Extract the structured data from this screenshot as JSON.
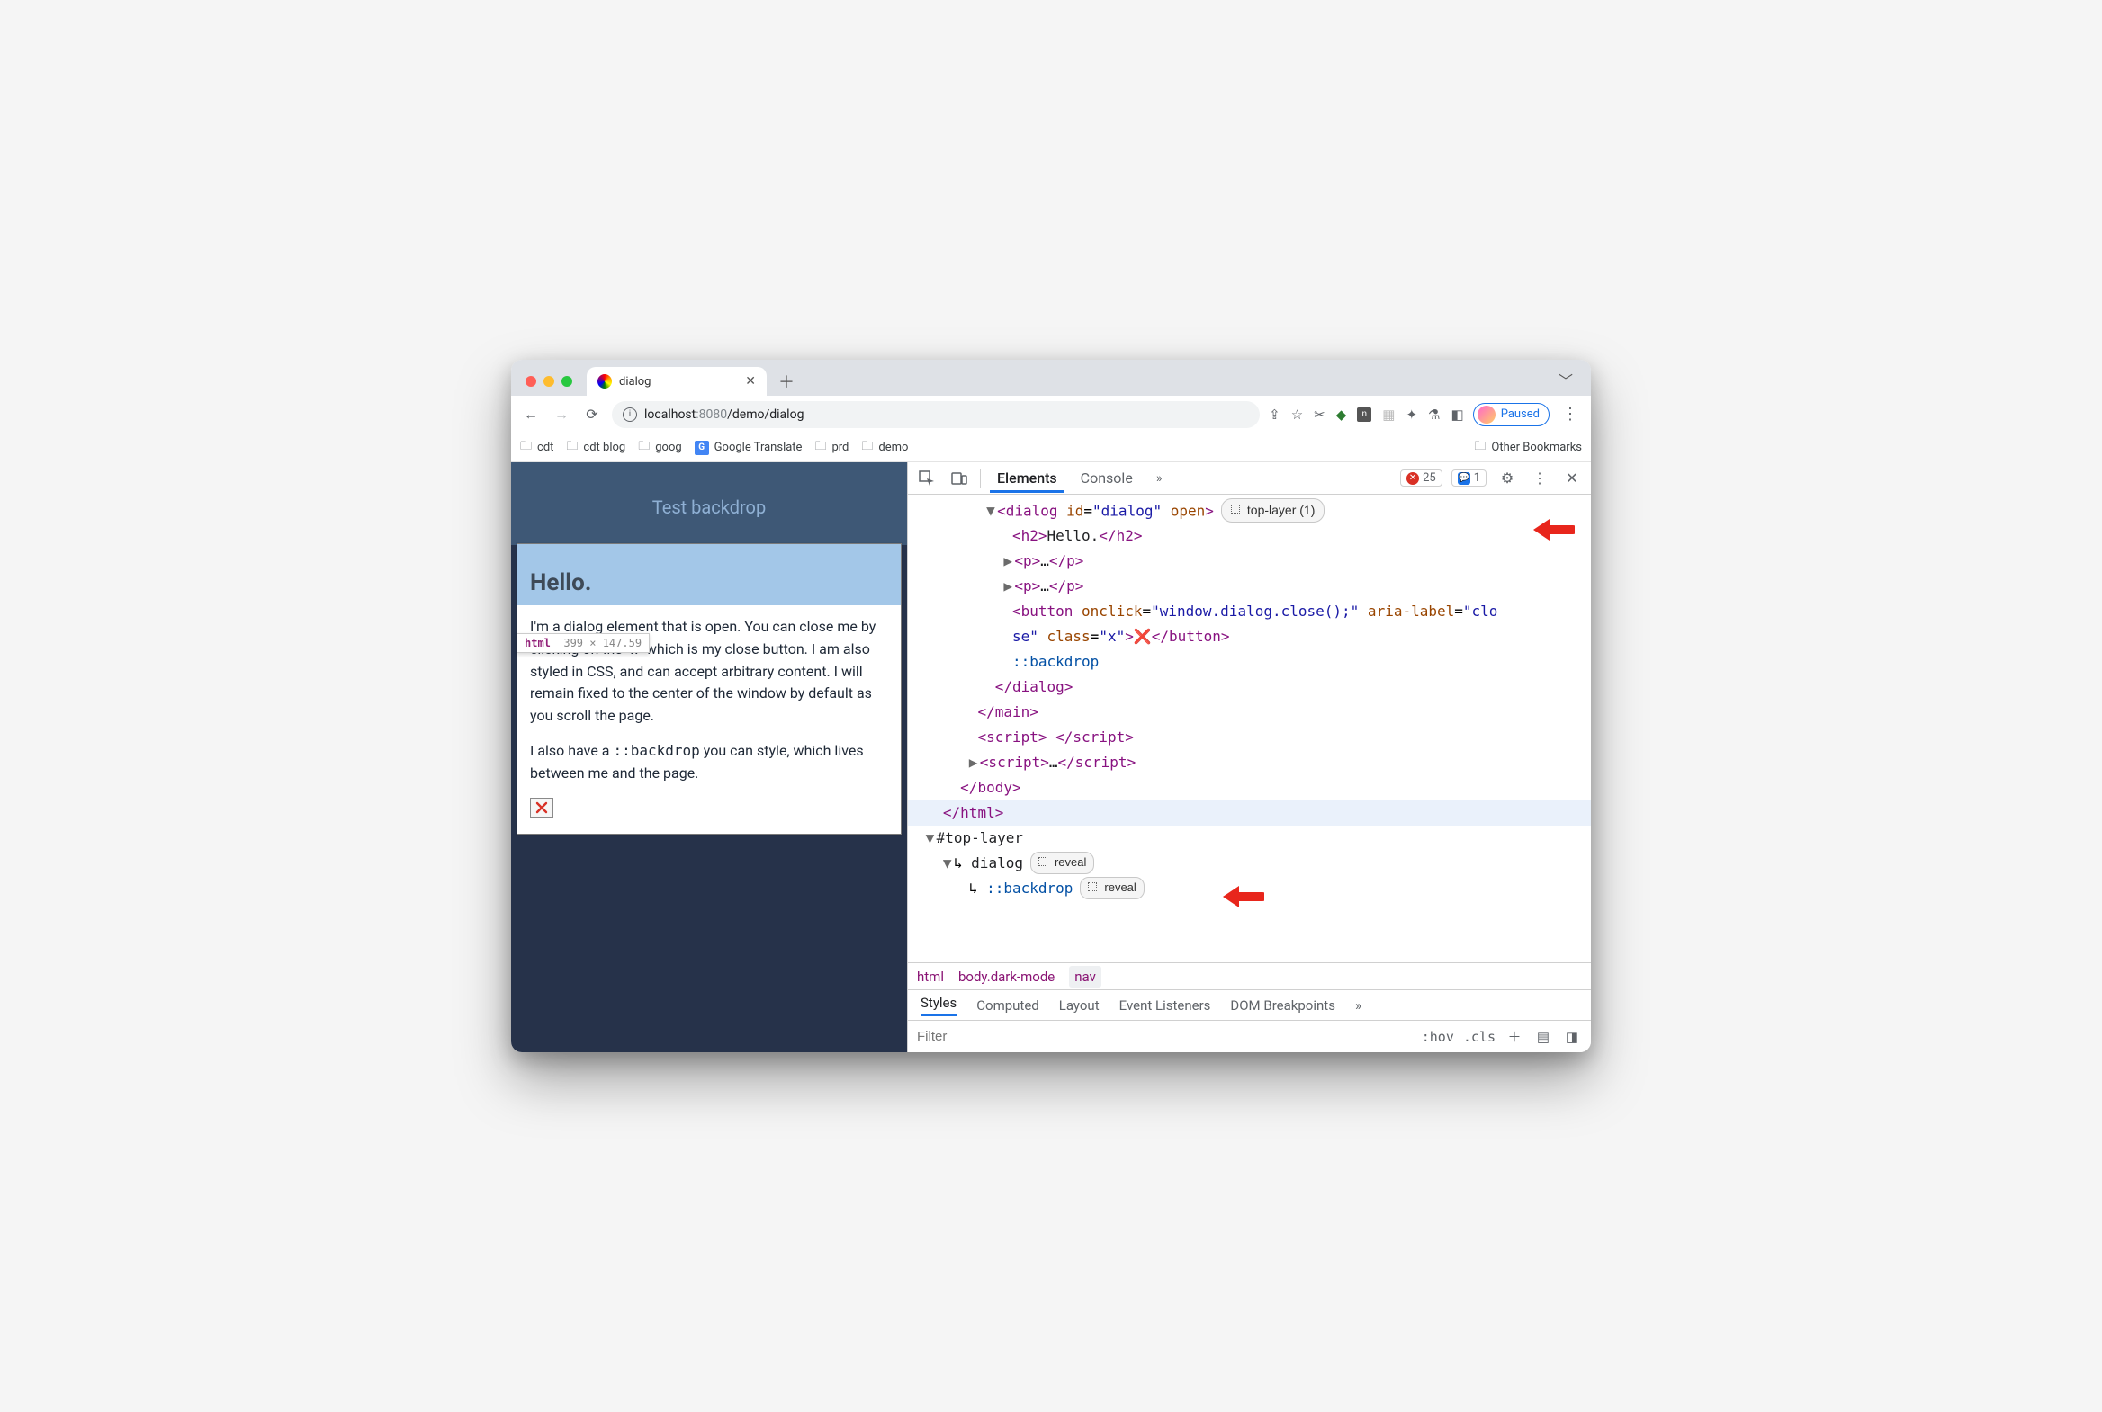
{
  "tab": {
    "title": "dialog"
  },
  "url": {
    "host": "localhost",
    "port": ":8080",
    "path": "/demo/dialog"
  },
  "profile": {
    "state": "Paused"
  },
  "bookmarks": {
    "items": [
      "cdt",
      "cdt blog",
      "goog",
      "Google Translate",
      "prd",
      "demo"
    ],
    "other": "Other Bookmarks"
  },
  "page": {
    "banner": "Test backdrop",
    "heading": "Hello.",
    "tooltip_el": "html",
    "tooltip_dims": "399 × 147.59",
    "para1": "I'm a dialog element that is open. You can close me by clicking on the \"x\" which is my close button. I am also styled in CSS, and can accept arbitrary content. I will remain fixed to the center of the window by default as you scroll the page.",
    "para2_a": "I also have a ",
    "para2_code": "::backdrop",
    "para2_b": " you can style, which lives between me and the page."
  },
  "devtools": {
    "tabs": {
      "elements": "Elements",
      "console": "Console"
    },
    "error_count": "25",
    "info_count": "1",
    "badge_top_layer": "top-layer (1)",
    "badge_reveal": "reveal",
    "crumbs": {
      "a": "html",
      "b": "body.dark-mode",
      "c": "nav"
    },
    "styles_tabs": [
      "Styles",
      "Computed",
      "Layout",
      "Event Listeners",
      "DOM Breakpoints"
    ],
    "filter_placeholder": "Filter",
    "filter_tools": {
      "hov": ":hov",
      "cls": ".cls"
    },
    "dom": {
      "l1": {
        "open": "<dialog ",
        "attr1": "id",
        "val1": "\"dialog\"",
        "attr2": " open",
        "close": ">"
      },
      "l2": {
        "open": "<h2>",
        "text": "Hello.",
        "close": "</h2>"
      },
      "l3": {
        "open": "<p>",
        "text": "…",
        "close": "</p>"
      },
      "l4": {
        "open": "<p>",
        "text": "…",
        "close": "</p>"
      },
      "l5": {
        "open": "<button ",
        "a1": "onclick",
        "v1": "\"window.dialog.close();\"",
        "a2": " aria-label",
        "v2": "\"clo"
      },
      "l5b": {
        "cont": "se\"",
        "a3": " class",
        "v3": "\"x\"",
        "mid": ">",
        "x": "❌",
        "close": "</button>"
      },
      "l6": "::backdrop",
      "l7": "</dialog>",
      "l8": "</main>",
      "l9": {
        "open": "<script>",
        "sp": " ",
        "close": "</script>"
      },
      "l10": {
        "open": "<script>",
        "text": "…",
        "close": "</script>"
      },
      "l11": "</body>",
      "l12": "</html>",
      "l13": "#top-layer",
      "l14": "dialog",
      "l15": "::backdrop"
    }
  }
}
